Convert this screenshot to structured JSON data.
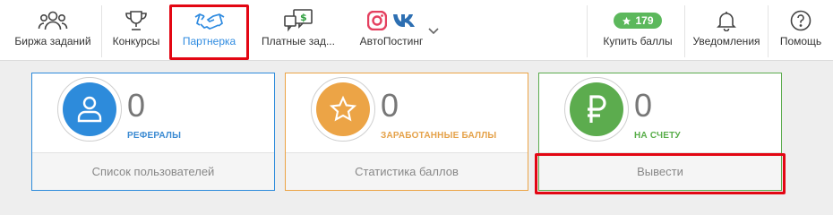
{
  "nav": {
    "birzha": "Биржа заданий",
    "konkursy": "Конкурсы",
    "partnerka": "Партнерка",
    "platnye": "Платные зад...",
    "autoposting": "АвтоПостинг",
    "balance_badge": "179",
    "buy_points": "Купить баллы",
    "notifications": "Уведомления",
    "help": "Помощь",
    "active_color": "#2f8be0"
  },
  "cards": [
    {
      "value": "0",
      "caption": "РЕФЕРАЛЫ",
      "footer": "Список пользователей",
      "color": "#2d8bdb",
      "caption_color": "#3a8ad2"
    },
    {
      "value": "0",
      "caption": "ЗАРАБОТАННЫЕ БАЛЛЫ",
      "footer": "Статистика баллов",
      "color": "#eca446",
      "caption_color": "#e5a24a"
    },
    {
      "value": "0",
      "caption": "НА СЧЕТУ",
      "footer": "Вывести",
      "color": "#5cac4e",
      "caption_color": "#58ad49"
    }
  ]
}
